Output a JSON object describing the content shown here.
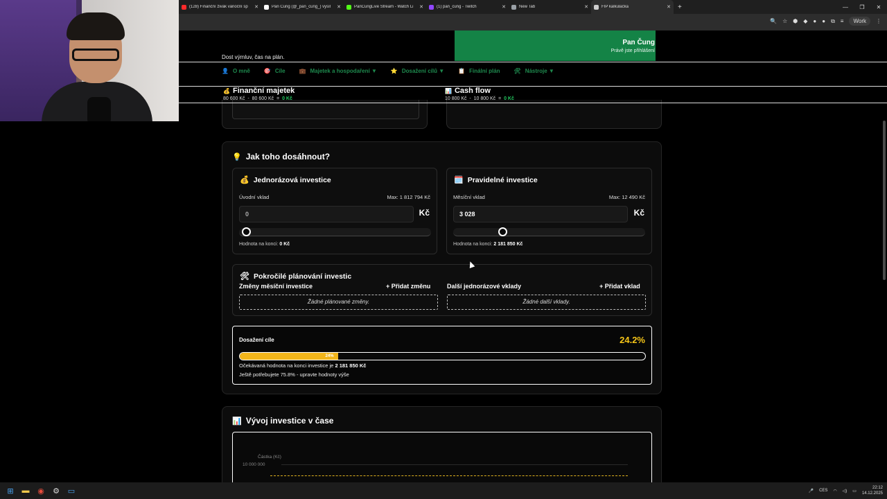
{
  "browser": {
    "tabs": [
      {
        "label": "(128) Finanční živák vánoční sp",
        "color": "#ff2a2a"
      },
      {
        "label": "Pan Čung (@_pan_cung_) vysíl",
        "color": "#ffffff"
      },
      {
        "label": "PanCungLive Stream - Watch Li",
        "color": "#53fc18"
      },
      {
        "label": "(1) pan_cung - Twitch",
        "color": "#9146ff"
      },
      {
        "label": "New Tab",
        "color": "#9aa0a6"
      },
      {
        "label": "FIP kalkulačka",
        "color": "#cccccc"
      }
    ],
    "new_tab": "+",
    "profile": "Work",
    "window_controls": [
      "—",
      "❐",
      "✕"
    ]
  },
  "header": {
    "user_name": "Pan Čung",
    "user_status": "Právě jste přihlášení",
    "tagline": "Dost výmluv, čas na plán.",
    "nav": [
      {
        "icon": "👤",
        "label": "O mně",
        "icon_name": "user-icon"
      },
      {
        "icon": "🎯",
        "label": "Cíle",
        "icon_name": "target-icon"
      },
      {
        "icon": "💼",
        "label": "Majetek a hospodaření ▼",
        "icon_name": "briefcase-icon"
      },
      {
        "icon": "⭐",
        "label": "Dosažení cílů ▼",
        "icon_name": "star-icon"
      },
      {
        "icon": "📋",
        "label": "Finální plán",
        "icon_name": "clipboard-icon"
      },
      {
        "icon": "🛠",
        "label": "Nástroje ▼",
        "icon_name": "tools-icon"
      }
    ],
    "summary_left": {
      "title": "Finanční majetek",
      "v1": "80 600 Kč",
      "sep1": "-",
      "v2": "80 600 Kč",
      "eq": "=",
      "result": "0 Kč"
    },
    "summary_right": {
      "title": "Cash flow",
      "v1": "10 800 Kč",
      "sep1": "-",
      "v2": "10 800 Kč",
      "eq": "=",
      "result": "0 Kč"
    }
  },
  "how": {
    "title": "Jak toho dosáhnout?",
    "lump": {
      "title": "Jednorázová investice",
      "field_label": "Úvodní vklad",
      "max": "Max: 1 812 794 Kč",
      "value": "0",
      "unit": "Kč",
      "end_label": "Hodnota na konci:",
      "end_value": "0 Kč",
      "slider_level": 0.0
    },
    "regular": {
      "title": "Pravidelné investice",
      "field_label": "Měsíční vklad",
      "max": "Max: 12 490 Kč",
      "value": "3 028",
      "unit": "Kč",
      "end_label": "Hodnota na konci:",
      "end_value": "2 181 850 Kč",
      "slider_level": 0.24
    },
    "advanced": {
      "title": "Pokročilé plánování investic",
      "left_sub": "Změny měsíční investice",
      "left_add": "+ Přidat změnu",
      "left_empty": "Žádné plánované změny.",
      "right_sub": "Další jednorázové vklady",
      "right_add": "+ Přidat vklad",
      "right_empty": "Žádné další vklady."
    },
    "goal": {
      "label": "Dosažení cíle",
      "percent": "24.2%",
      "bar_text": "24%",
      "progress": 0.242,
      "expected_prefix": "Očekávaná hodnota na konci investice je",
      "expected_value": "2 181 850 Kč",
      "need_text": "Ještě potřebujete 75.8% - upravte hodnoty výše"
    }
  },
  "chart": {
    "title": "Vývoj investice v čase",
    "y_axis_title": "Částka (Kč)",
    "y_tick": "10 000 000"
  },
  "taskbar": {
    "lang": "CES",
    "time": "22:12",
    "date": "14.12.2025"
  }
}
